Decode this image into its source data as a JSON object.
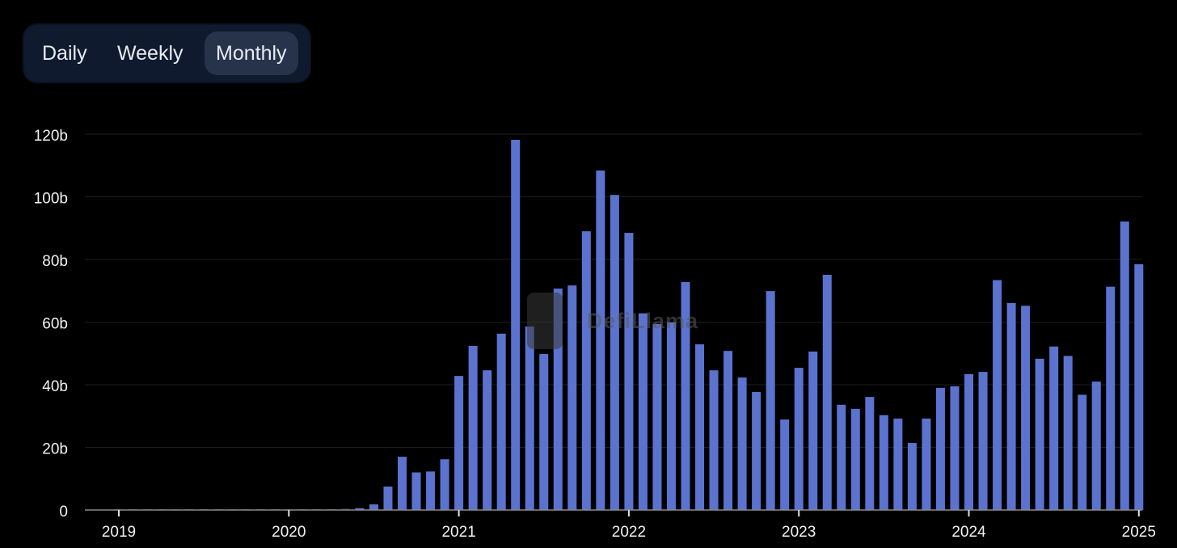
{
  "toggle": {
    "options": [
      "Daily",
      "Weekly",
      "Monthly"
    ],
    "selected": "Monthly"
  },
  "watermark": {
    "text": "DefiLlama"
  },
  "colors": {
    "bar": "#5b73cf",
    "background": "#000000",
    "grid": "#1e1e1e",
    "axis": "#8a8a8a"
  },
  "chart_data": {
    "type": "bar",
    "title": "",
    "xlabel": "",
    "ylabel": "",
    "ylim": [
      0,
      120
    ],
    "yticks": [
      0,
      20,
      40,
      60,
      80,
      100,
      120
    ],
    "ytick_labels": [
      "0",
      "20b",
      "40b",
      "60b",
      "80b",
      "100b",
      "120b"
    ],
    "xticks": [
      "2019",
      "2020",
      "2021",
      "2022",
      "2023",
      "2024",
      "2025"
    ],
    "unit": "billions",
    "grid": true,
    "categories": [
      "2019-01",
      "2019-02",
      "2019-03",
      "2019-04",
      "2019-05",
      "2019-06",
      "2019-07",
      "2019-08",
      "2019-09",
      "2019-10",
      "2019-11",
      "2019-12",
      "2020-01",
      "2020-02",
      "2020-03",
      "2020-04",
      "2020-05",
      "2020-06",
      "2020-07",
      "2020-08",
      "2020-09",
      "2020-10",
      "2020-11",
      "2020-12",
      "2021-01",
      "2021-02",
      "2021-03",
      "2021-04",
      "2021-05",
      "2021-06",
      "2021-07",
      "2021-08",
      "2021-09",
      "2021-10",
      "2021-11",
      "2021-12",
      "2022-01",
      "2022-02",
      "2022-03",
      "2022-04",
      "2022-05",
      "2022-06",
      "2022-07",
      "2022-08",
      "2022-09",
      "2022-10",
      "2022-11",
      "2022-12",
      "2023-01",
      "2023-02",
      "2023-03",
      "2023-04",
      "2023-05",
      "2023-06",
      "2023-07",
      "2023-08",
      "2023-09",
      "2023-10",
      "2023-11",
      "2023-12",
      "2024-01",
      "2024-02",
      "2024-03",
      "2024-04",
      "2024-05",
      "2024-06",
      "2024-07",
      "2024-08",
      "2024-09",
      "2024-10",
      "2024-11",
      "2024-12",
      "2025-01"
    ],
    "values": [
      0.02,
      0.02,
      0.02,
      0.02,
      0.02,
      0.02,
      0.02,
      0.02,
      0.02,
      0.02,
      0.02,
      0.02,
      0.1,
      0.2,
      0.3,
      0.3,
      0.4,
      0.6,
      1.8,
      7.5,
      17.0,
      12.0,
      12.3,
      16.2,
      42.8,
      52.4,
      44.6,
      56.3,
      118.2,
      58.6,
      49.8,
      70.7,
      71.7,
      89.0,
      108.4,
      100.6,
      88.5,
      62.8,
      59.4,
      59.9,
      72.8,
      52.9,
      44.6,
      50.8,
      42.3,
      37.7,
      69.9,
      28.9,
      45.4,
      50.6,
      75.1,
      33.6,
      32.3,
      36.1,
      30.3,
      29.2,
      21.4,
      29.2,
      39.0,
      39.5,
      43.4,
      44.1,
      73.4,
      66.1,
      65.2,
      48.3,
      52.2,
      49.2,
      36.8,
      41.0,
      71.3,
      92.1,
      78.5
    ]
  }
}
